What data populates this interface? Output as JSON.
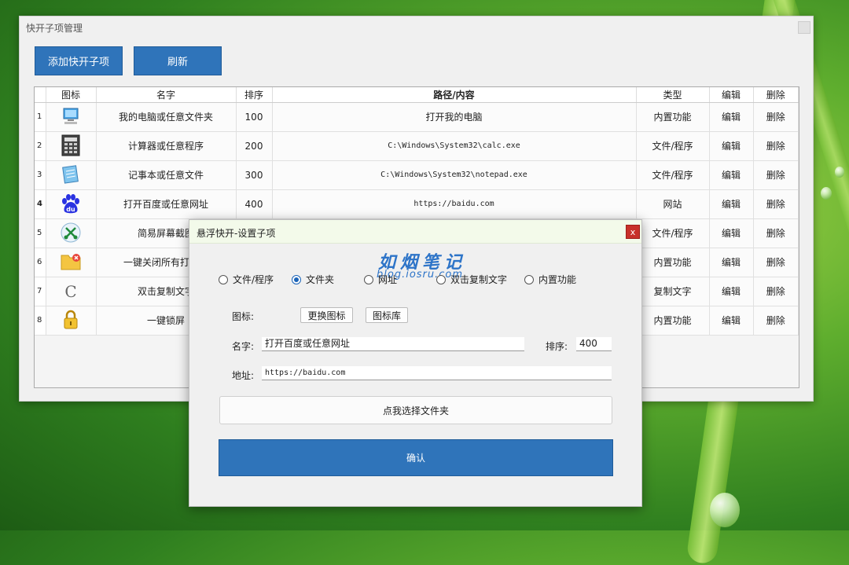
{
  "main_window": {
    "title": "快开子项管理",
    "add_button": "添加快开子项",
    "refresh_button": "刷新"
  },
  "table": {
    "columns": [
      "图标",
      "名字",
      "排序",
      "路径/内容",
      "类型",
      "编辑",
      "删除"
    ],
    "rows": [
      {
        "num": "1",
        "icon": "computer-icon",
        "name": "我的电脑或任意文件夹",
        "order": "100",
        "path": "打开我的电脑",
        "type": "内置功能",
        "edit": "编辑",
        "delete": "删除"
      },
      {
        "num": "2",
        "icon": "calculator-icon",
        "name": "计算器或任意程序",
        "order": "200",
        "path": "C:\\Windows\\System32\\calc.exe",
        "type": "文件/程序",
        "edit": "编辑",
        "delete": "删除"
      },
      {
        "num": "3",
        "icon": "notepad-icon",
        "name": "记事本或任意文件",
        "order": "300",
        "path": "C:\\Windows\\System32\\notepad.exe",
        "type": "文件/程序",
        "edit": "编辑",
        "delete": "删除"
      },
      {
        "num": "4",
        "icon": "baidu-icon",
        "name": "打开百度或任意网址",
        "order": "400",
        "path": "https://baidu.com",
        "type": "网站",
        "edit": "编辑",
        "delete": "删除"
      },
      {
        "num": "5",
        "icon": "screenshot-icon",
        "name": "简易屏幕截图",
        "order": "",
        "path": "",
        "type": "文件/程序",
        "edit": "编辑",
        "delete": "删除"
      },
      {
        "num": "6",
        "icon": "folder-close-icon",
        "name": "一键关闭所有打开的",
        "order": "",
        "path": "",
        "type": "内置功能",
        "edit": "编辑",
        "delete": "删除"
      },
      {
        "num": "7",
        "icon": "copy-text-icon",
        "name": "双击复制文字",
        "order": "",
        "path": "",
        "type": "复制文字",
        "edit": "编辑",
        "delete": "删除"
      },
      {
        "num": "8",
        "icon": "lock-icon",
        "name": "一键锁屏",
        "order": "",
        "path": "",
        "type": "内置功能",
        "edit": "编辑",
        "delete": "删除"
      }
    ]
  },
  "dialog": {
    "title": "悬浮快开-设置子项",
    "close": "x",
    "watermark_title": "如烟笔记",
    "watermark_sub": "blog.iosru.com",
    "radio_options": [
      "文件/程序",
      "文件夹",
      "网址",
      "双击复制文字",
      "内置功能"
    ],
    "selected_option": "文件夹",
    "icon_label": "图标:",
    "change_icon_button": "更换图标",
    "icon_library_button": "图标库",
    "name_label": "名字:",
    "name_value": "打开百度或任意网址",
    "order_label": "排序:",
    "order_value": "400",
    "address_label": "地址:",
    "address_value": "https://baidu.com",
    "choose_folder_button": "点我选择文件夹",
    "confirm_button": "确认"
  }
}
